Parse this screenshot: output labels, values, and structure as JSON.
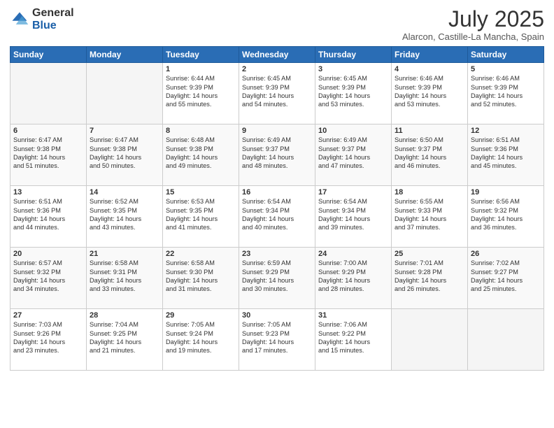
{
  "logo": {
    "general": "General",
    "blue": "Blue"
  },
  "title": "July 2025",
  "location": "Alarcon, Castille-La Mancha, Spain",
  "days_of_week": [
    "Sunday",
    "Monday",
    "Tuesday",
    "Wednesday",
    "Thursday",
    "Friday",
    "Saturday"
  ],
  "weeks": [
    [
      {
        "day": "",
        "lines": []
      },
      {
        "day": "",
        "lines": []
      },
      {
        "day": "1",
        "lines": [
          "Sunrise: 6:44 AM",
          "Sunset: 9:39 PM",
          "Daylight: 14 hours",
          "and 55 minutes."
        ]
      },
      {
        "day": "2",
        "lines": [
          "Sunrise: 6:45 AM",
          "Sunset: 9:39 PM",
          "Daylight: 14 hours",
          "and 54 minutes."
        ]
      },
      {
        "day": "3",
        "lines": [
          "Sunrise: 6:45 AM",
          "Sunset: 9:39 PM",
          "Daylight: 14 hours",
          "and 53 minutes."
        ]
      },
      {
        "day": "4",
        "lines": [
          "Sunrise: 6:46 AM",
          "Sunset: 9:39 PM",
          "Daylight: 14 hours",
          "and 53 minutes."
        ]
      },
      {
        "day": "5",
        "lines": [
          "Sunrise: 6:46 AM",
          "Sunset: 9:39 PM",
          "Daylight: 14 hours",
          "and 52 minutes."
        ]
      }
    ],
    [
      {
        "day": "6",
        "lines": [
          "Sunrise: 6:47 AM",
          "Sunset: 9:38 PM",
          "Daylight: 14 hours",
          "and 51 minutes."
        ]
      },
      {
        "day": "7",
        "lines": [
          "Sunrise: 6:47 AM",
          "Sunset: 9:38 PM",
          "Daylight: 14 hours",
          "and 50 minutes."
        ]
      },
      {
        "day": "8",
        "lines": [
          "Sunrise: 6:48 AM",
          "Sunset: 9:38 PM",
          "Daylight: 14 hours",
          "and 49 minutes."
        ]
      },
      {
        "day": "9",
        "lines": [
          "Sunrise: 6:49 AM",
          "Sunset: 9:37 PM",
          "Daylight: 14 hours",
          "and 48 minutes."
        ]
      },
      {
        "day": "10",
        "lines": [
          "Sunrise: 6:49 AM",
          "Sunset: 9:37 PM",
          "Daylight: 14 hours",
          "and 47 minutes."
        ]
      },
      {
        "day": "11",
        "lines": [
          "Sunrise: 6:50 AM",
          "Sunset: 9:37 PM",
          "Daylight: 14 hours",
          "and 46 minutes."
        ]
      },
      {
        "day": "12",
        "lines": [
          "Sunrise: 6:51 AM",
          "Sunset: 9:36 PM",
          "Daylight: 14 hours",
          "and 45 minutes."
        ]
      }
    ],
    [
      {
        "day": "13",
        "lines": [
          "Sunrise: 6:51 AM",
          "Sunset: 9:36 PM",
          "Daylight: 14 hours",
          "and 44 minutes."
        ]
      },
      {
        "day": "14",
        "lines": [
          "Sunrise: 6:52 AM",
          "Sunset: 9:35 PM",
          "Daylight: 14 hours",
          "and 43 minutes."
        ]
      },
      {
        "day": "15",
        "lines": [
          "Sunrise: 6:53 AM",
          "Sunset: 9:35 PM",
          "Daylight: 14 hours",
          "and 41 minutes."
        ]
      },
      {
        "day": "16",
        "lines": [
          "Sunrise: 6:54 AM",
          "Sunset: 9:34 PM",
          "Daylight: 14 hours",
          "and 40 minutes."
        ]
      },
      {
        "day": "17",
        "lines": [
          "Sunrise: 6:54 AM",
          "Sunset: 9:34 PM",
          "Daylight: 14 hours",
          "and 39 minutes."
        ]
      },
      {
        "day": "18",
        "lines": [
          "Sunrise: 6:55 AM",
          "Sunset: 9:33 PM",
          "Daylight: 14 hours",
          "and 37 minutes."
        ]
      },
      {
        "day": "19",
        "lines": [
          "Sunrise: 6:56 AM",
          "Sunset: 9:32 PM",
          "Daylight: 14 hours",
          "and 36 minutes."
        ]
      }
    ],
    [
      {
        "day": "20",
        "lines": [
          "Sunrise: 6:57 AM",
          "Sunset: 9:32 PM",
          "Daylight: 14 hours",
          "and 34 minutes."
        ]
      },
      {
        "day": "21",
        "lines": [
          "Sunrise: 6:58 AM",
          "Sunset: 9:31 PM",
          "Daylight: 14 hours",
          "and 33 minutes."
        ]
      },
      {
        "day": "22",
        "lines": [
          "Sunrise: 6:58 AM",
          "Sunset: 9:30 PM",
          "Daylight: 14 hours",
          "and 31 minutes."
        ]
      },
      {
        "day": "23",
        "lines": [
          "Sunrise: 6:59 AM",
          "Sunset: 9:29 PM",
          "Daylight: 14 hours",
          "and 30 minutes."
        ]
      },
      {
        "day": "24",
        "lines": [
          "Sunrise: 7:00 AM",
          "Sunset: 9:29 PM",
          "Daylight: 14 hours",
          "and 28 minutes."
        ]
      },
      {
        "day": "25",
        "lines": [
          "Sunrise: 7:01 AM",
          "Sunset: 9:28 PM",
          "Daylight: 14 hours",
          "and 26 minutes."
        ]
      },
      {
        "day": "26",
        "lines": [
          "Sunrise: 7:02 AM",
          "Sunset: 9:27 PM",
          "Daylight: 14 hours",
          "and 25 minutes."
        ]
      }
    ],
    [
      {
        "day": "27",
        "lines": [
          "Sunrise: 7:03 AM",
          "Sunset: 9:26 PM",
          "Daylight: 14 hours",
          "and 23 minutes."
        ]
      },
      {
        "day": "28",
        "lines": [
          "Sunrise: 7:04 AM",
          "Sunset: 9:25 PM",
          "Daylight: 14 hours",
          "and 21 minutes."
        ]
      },
      {
        "day": "29",
        "lines": [
          "Sunrise: 7:05 AM",
          "Sunset: 9:24 PM",
          "Daylight: 14 hours",
          "and 19 minutes."
        ]
      },
      {
        "day": "30",
        "lines": [
          "Sunrise: 7:05 AM",
          "Sunset: 9:23 PM",
          "Daylight: 14 hours",
          "and 17 minutes."
        ]
      },
      {
        "day": "31",
        "lines": [
          "Sunrise: 7:06 AM",
          "Sunset: 9:22 PM",
          "Daylight: 14 hours",
          "and 15 minutes."
        ]
      },
      {
        "day": "",
        "lines": []
      },
      {
        "day": "",
        "lines": []
      }
    ]
  ]
}
